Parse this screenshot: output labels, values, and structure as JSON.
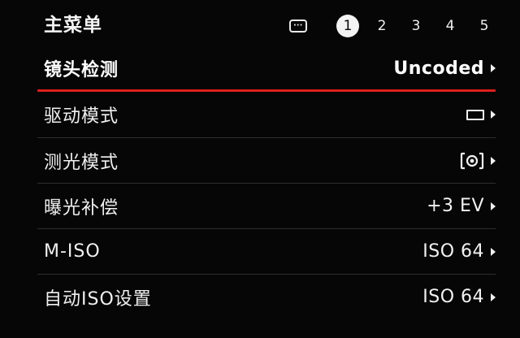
{
  "header": {
    "title": "主菜单",
    "more_icon": "more-pages-icon",
    "tabs": [
      "1",
      "2",
      "3",
      "4",
      "5"
    ],
    "active_tab": "1"
  },
  "rows": [
    {
      "label": "镜头检测",
      "value": "Uncoded"
    },
    {
      "label": "驱动模式",
      "value_icon": "single-frame-rect-icon"
    },
    {
      "label": "测光模式",
      "value_icon": "multi-field-metering-icon"
    },
    {
      "label": "曝光补偿",
      "value": "+3 EV"
    },
    {
      "label": "M-ISO",
      "value": "ISO 64"
    },
    {
      "label": "自动ISO设置",
      "value": "ISO 64"
    }
  ],
  "colors": {
    "background": "#060606",
    "selection": "#e01e1e",
    "text": "#f2f2f2"
  }
}
